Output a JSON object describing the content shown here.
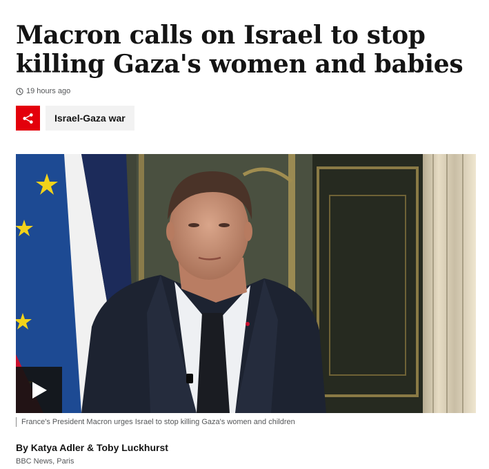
{
  "article": {
    "headline": "Macron calls on Israel to stop killing Gaza's women and babies",
    "timestamp": "19 hours ago",
    "topic_tag": "Israel-Gaza war",
    "media": {
      "caption": "France's President Macron urges Israel to stop killing Gaza's women and children"
    },
    "byline": {
      "authors": "By Katya Adler & Toby Luckhurst",
      "location": "BBC News, Paris"
    }
  },
  "icons": {
    "clock": "clock-icon",
    "share": "share-icon",
    "play": "play-icon"
  },
  "colors": {
    "share_button_bg": "#e3000b",
    "tag_bg": "#f2f2f2",
    "headline_text": "#141414",
    "meta_text": "#545658"
  }
}
